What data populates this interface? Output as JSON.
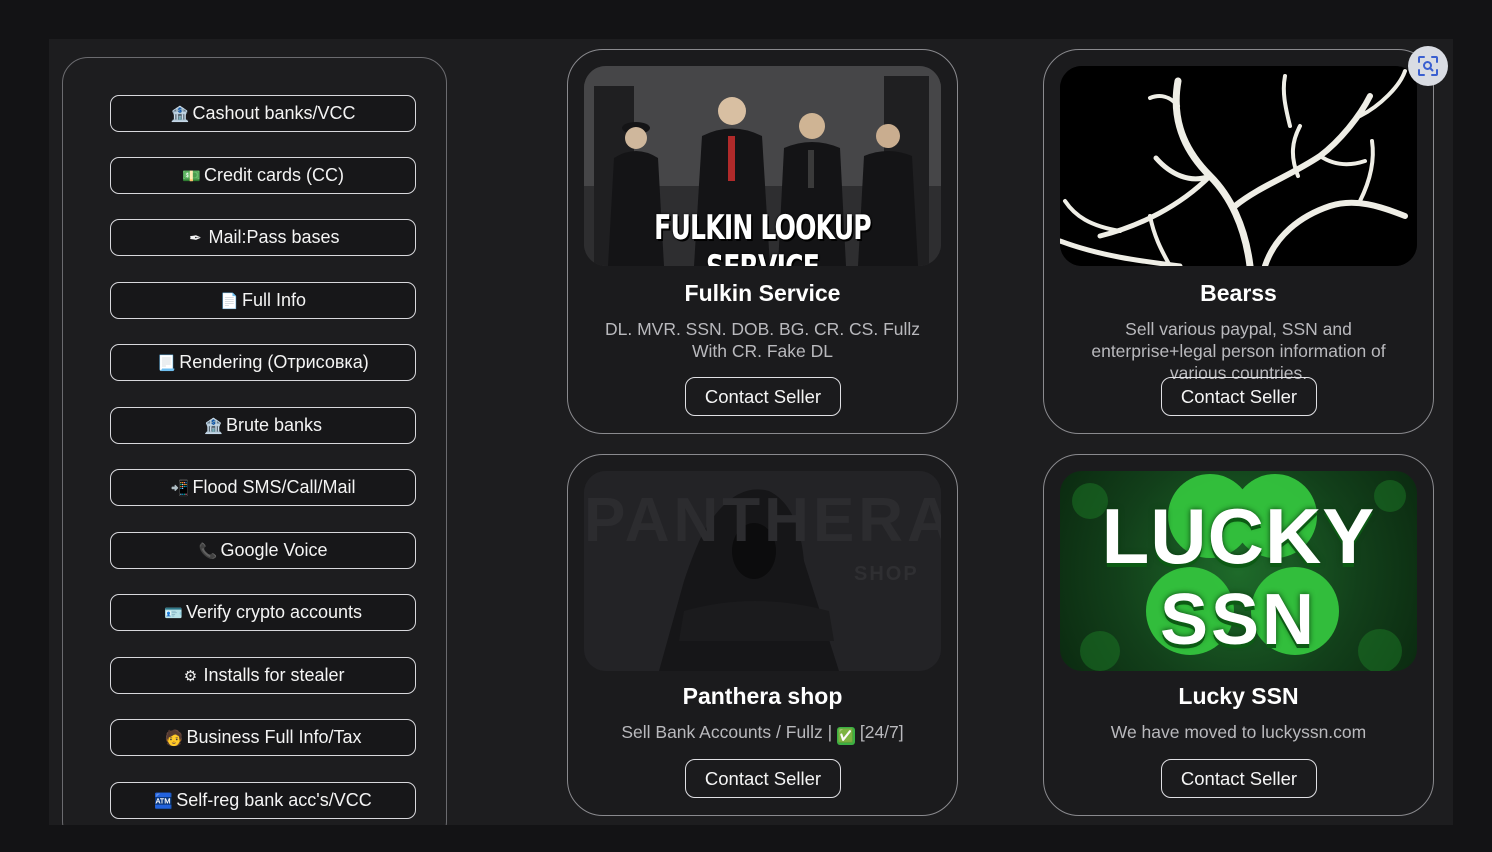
{
  "sidebar": {
    "items": [
      {
        "icon": "bank-icon",
        "glyph": "🏦",
        "label": "Cashout banks/VCC"
      },
      {
        "icon": "money-icon",
        "glyph": "💵",
        "label": "Credit cards (CC)"
      },
      {
        "icon": "pen-icon",
        "glyph": "✒",
        "label": "Mail:Pass bases"
      },
      {
        "icon": "document-icon",
        "glyph": "📄",
        "label": "Full Info"
      },
      {
        "icon": "page-icon",
        "glyph": "📃",
        "label": "Rendering (Отрисовка)"
      },
      {
        "icon": "bank-icon",
        "glyph": "🏦",
        "label": "Brute banks"
      },
      {
        "icon": "incoming-phone-icon",
        "glyph": "📲",
        "label": "Flood SMS/Call/Mail"
      },
      {
        "icon": "phone-icon",
        "glyph": "📞",
        "label": "Google Voice"
      },
      {
        "icon": "id-card-icon",
        "glyph": "🪪",
        "label": "Verify crypto accounts"
      },
      {
        "icon": "gear-icon",
        "glyph": "⚙",
        "label": "Installs for stealer"
      },
      {
        "icon": "businessman-icon",
        "glyph": "🧑",
        "label": "Business Full Info/Tax"
      },
      {
        "icon": "atm-icon",
        "glyph": "🏧",
        "label": "Self-reg bank acc's/VCC"
      }
    ]
  },
  "sellers": [
    {
      "name": "Fulkin Service",
      "banner_text": "FULKIN LOOKUP SERVICE",
      "description": "DL. MVR. SSN. DOB. BG. CR. CS. Fullz With CR. Fake DL",
      "contact_label": "Contact Seller"
    },
    {
      "name": "Bearss",
      "description": "Sell various paypal, SSN and enterprise+legal person information of various countries.",
      "contact_label": "Contact Seller"
    },
    {
      "name": "Panthera shop",
      "banner_text": "PANTHERA",
      "banner_subtext": "SHOP",
      "description_prefix": "Sell Bank Accounts / Fullz | ",
      "check_glyph": "✅",
      "description_suffix": " [24/7]",
      "contact_label": "Contact Seller"
    },
    {
      "name": "Lucky SSN",
      "banner_line1": "LUCKY",
      "banner_line2": "SSN",
      "description": "We have moved to luckyssn.com",
      "contact_label": "Contact Seller"
    }
  ],
  "colors": {
    "background": "#131315",
    "panel": "#1d1d1f",
    "lucky_green": "#1fae2e",
    "check_green": "#3cb043"
  }
}
